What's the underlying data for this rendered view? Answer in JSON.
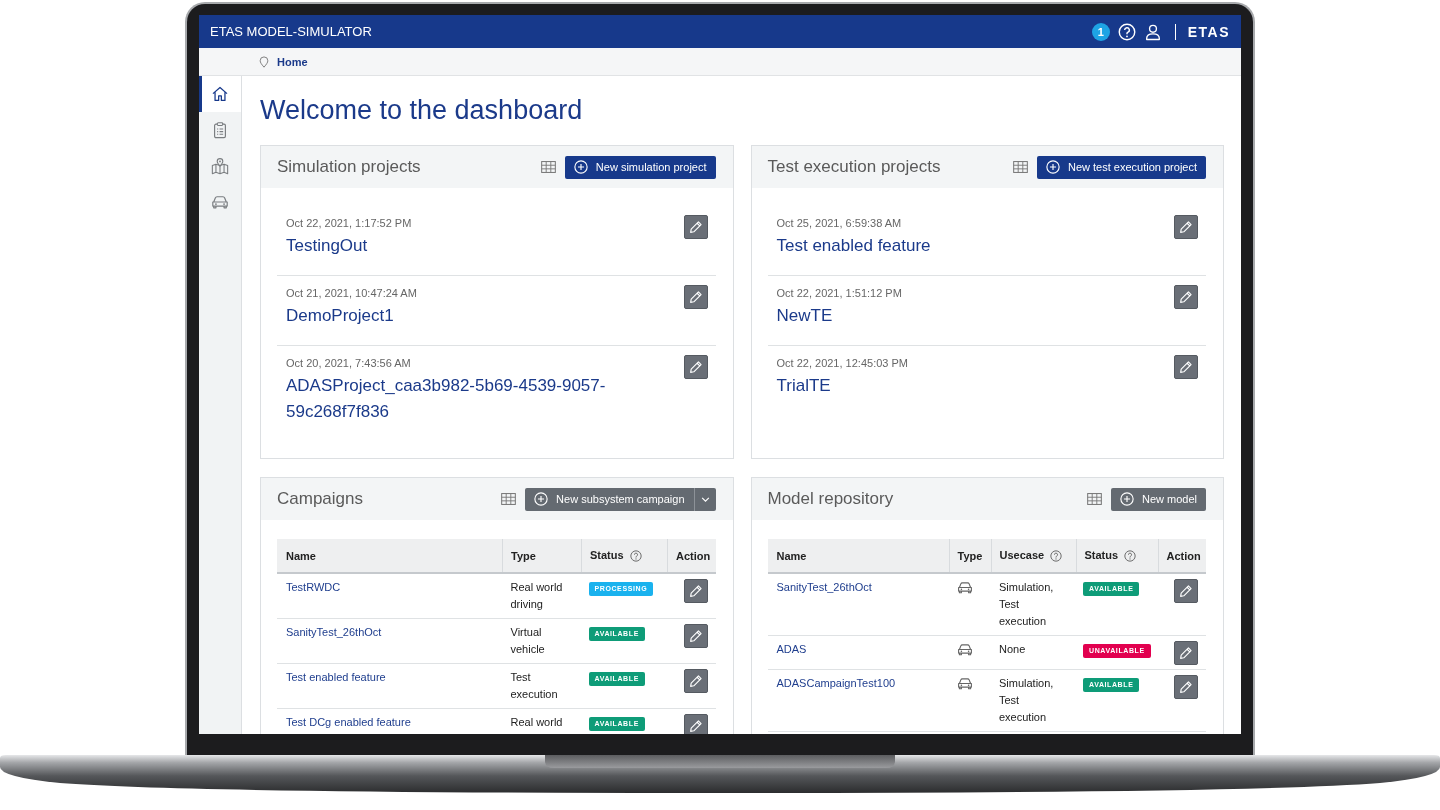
{
  "top_bar": {
    "title": "ETAS MODEL-SIMULATOR",
    "notification_count": "1",
    "logo": "ETAS"
  },
  "breadcrumb": {
    "items": [
      "Home"
    ]
  },
  "sidebar": {
    "items": [
      {
        "selected": true
      },
      {
        "selected": false
      },
      {
        "selected": false
      },
      {
        "selected": false
      }
    ]
  },
  "heading": "Welcome to the dashboard",
  "cards": [
    {
      "kind": "list",
      "title": "Simulation projects",
      "button": {
        "label": "New simulation project",
        "kind": "primary",
        "menu": false
      },
      "items": [
        {
          "date": "Oct 22, 2021, 1:17:52 PM",
          "name": "TestingOut"
        },
        {
          "date": "Oct 21, 2021, 10:47:24 AM",
          "name": "DemoProject1"
        },
        {
          "date": "Oct 20, 2021, 7:43:56 AM",
          "name": "ADASProject_caa3b982-5b69-4539-9057-59c268f7f836"
        }
      ]
    },
    {
      "kind": "list",
      "title": "Test execution projects",
      "button": {
        "label": "New test execution project",
        "kind": "primary",
        "menu": false
      },
      "items": [
        {
          "date": "Oct 25, 2021, 6:59:38 AM",
          "name": "Test enabled feature"
        },
        {
          "date": "Oct 22, 2021, 1:51:12 PM",
          "name": "NewTE"
        },
        {
          "date": "Oct 22, 2021, 12:45:03 PM",
          "name": "TrialTE"
        }
      ]
    },
    {
      "kind": "table",
      "title": "Campaigns",
      "button": {
        "label": "New subsystem campaign",
        "kind": "secondary",
        "menu": true
      },
      "columns": [
        {
          "label": "Name",
          "help": false
        },
        {
          "label": "Type",
          "help": false
        },
        {
          "label": "Status",
          "help": true
        },
        {
          "label": "Action",
          "help": false
        }
      ],
      "rows": [
        {
          "cells": [
            {
              "kind": "link",
              "text": "TestRWDC"
            },
            {
              "kind": "text",
              "text": "Real world driving"
            },
            {
              "kind": "badge",
              "text": "PROCESSING",
              "color": "#1ab2ee"
            },
            {
              "kind": "edit"
            }
          ]
        },
        {
          "cells": [
            {
              "kind": "link",
              "text": "SanityTest_26thOct"
            },
            {
              "kind": "text",
              "text": "Virtual vehicle"
            },
            {
              "kind": "badge",
              "text": "AVAILABLE",
              "color": "#0e9c78"
            },
            {
              "kind": "edit"
            }
          ]
        },
        {
          "cells": [
            {
              "kind": "link",
              "text": "Test enabled feature"
            },
            {
              "kind": "text",
              "text": "Test execution"
            },
            {
              "kind": "badge",
              "text": "AVAILABLE",
              "color": "#0e9c78"
            },
            {
              "kind": "edit"
            }
          ]
        },
        {
          "cells": [
            {
              "kind": "link",
              "text": "Test DCg enabled feature"
            },
            {
              "kind": "text",
              "text": "Real world"
            },
            {
              "kind": "badge",
              "text": "AVAILABLE",
              "color": "#0e9c78"
            },
            {
              "kind": "edit"
            }
          ]
        }
      ]
    },
    {
      "kind": "table",
      "title": "Model repository",
      "button": {
        "label": "New model",
        "kind": "secondary",
        "menu": false
      },
      "columns": [
        {
          "label": "Name",
          "help": false
        },
        {
          "label": "Type",
          "help": false
        },
        {
          "label": "Usecase",
          "help": true
        },
        {
          "label": "Status",
          "help": true
        },
        {
          "label": "Action",
          "help": false
        }
      ],
      "rows": [
        {
          "cells": [
            {
              "kind": "link",
              "text": "SanityTest_26thOct"
            },
            {
              "kind": "icon"
            },
            {
              "kind": "text",
              "text": "Simulation, Test execution"
            },
            {
              "kind": "badge",
              "text": "AVAILABLE",
              "color": "#0e9c78"
            },
            {
              "kind": "edit"
            }
          ]
        },
        {
          "cells": [
            {
              "kind": "link",
              "text": "ADAS"
            },
            {
              "kind": "icon"
            },
            {
              "kind": "text",
              "text": "None"
            },
            {
              "kind": "badge",
              "text": "UNAVAILABLE",
              "color": "#e2004f"
            },
            {
              "kind": "edit"
            }
          ]
        },
        {
          "cells": [
            {
              "kind": "link",
              "text": "ADASCampaignTest100"
            },
            {
              "kind": "icon"
            },
            {
              "kind": "text",
              "text": "Simulation, Test execution"
            },
            {
              "kind": "badge",
              "text": "AVAILABLE",
              "color": "#0e9c78"
            },
            {
              "kind": "edit"
            }
          ]
        }
      ]
    }
  ]
}
